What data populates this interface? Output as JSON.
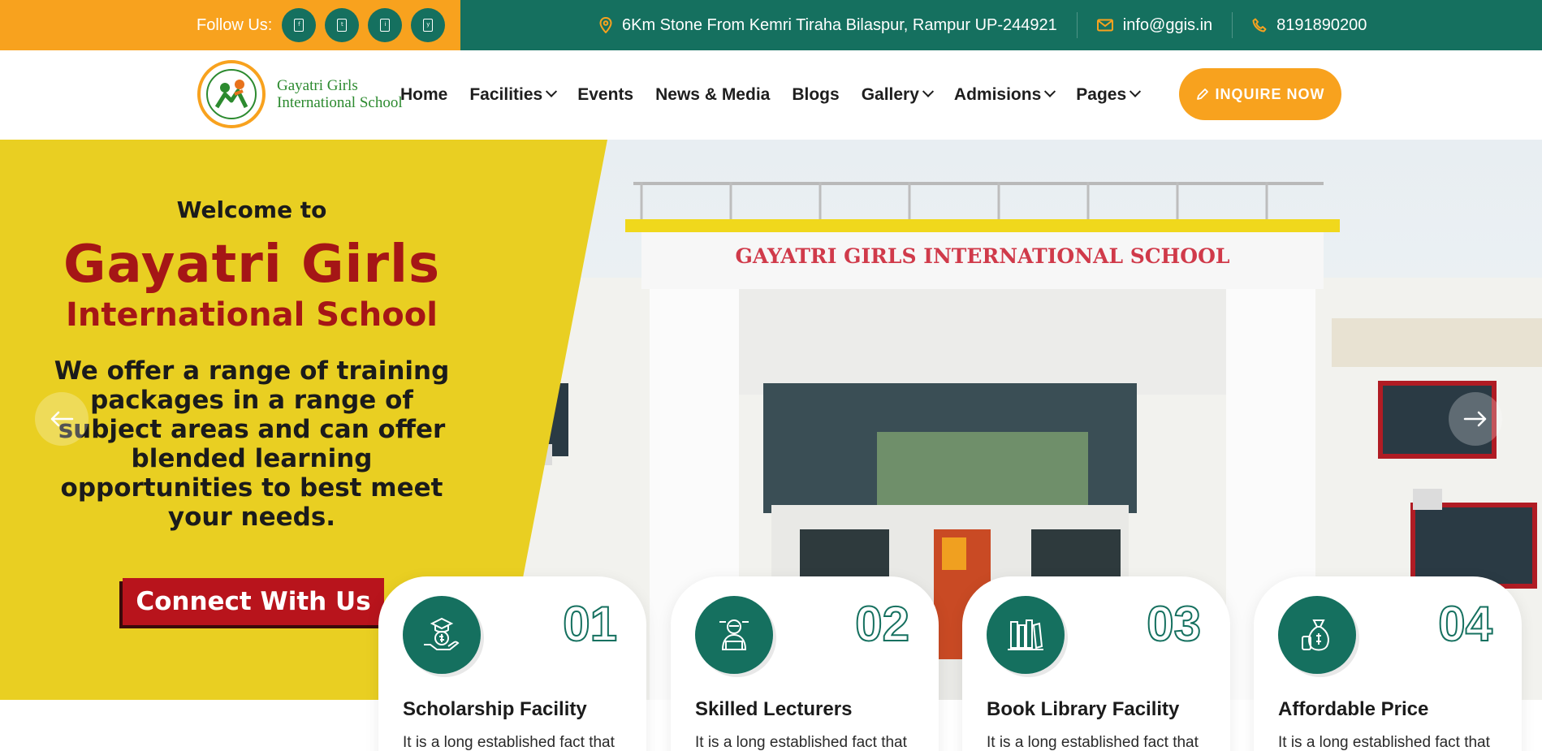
{
  "topbar": {
    "follow_label": "Follow Us:",
    "social_icons": [
      "facebook-icon",
      "twitter-icon",
      "instagram-icon",
      "youtube-icon"
    ],
    "address": "6Km Stone From Kemri Tiraha Bilaspur, Rampur UP-244921",
    "email": "info@ggis.in",
    "phone": "8191890200"
  },
  "logo": {
    "line1": "Gayatri Girls",
    "line2": "International School",
    "emblem_text": "Gayatri Girls International School"
  },
  "nav": {
    "items": [
      {
        "label": "Home",
        "dropdown": false
      },
      {
        "label": "Facilities",
        "dropdown": true
      },
      {
        "label": "Events",
        "dropdown": false
      },
      {
        "label": "News & Media",
        "dropdown": false
      },
      {
        "label": "Blogs",
        "dropdown": false
      },
      {
        "label": "Gallery",
        "dropdown": true
      },
      {
        "label": "Admisions",
        "dropdown": true
      },
      {
        "label": "Pages",
        "dropdown": true
      }
    ],
    "inquire_label": "INQUIRE NOW"
  },
  "hero": {
    "welcome": "Welcome to",
    "school_name_1": "Gayatri Girls",
    "school_name_2": "International School",
    "tagline": "We offer a range of training packages in a range of subject areas and can offer blended learning opportunities to best meet your needs.",
    "connect_label": "Connect With Us",
    "building_sign": "GAYATRI GIRLS  INTERNATIONAL SCHOOL"
  },
  "cards": [
    {
      "num": "01",
      "title": "Scholarship Facility",
      "desc": "It is a long established fact that",
      "icon": "scholarship-icon"
    },
    {
      "num": "02",
      "title": "Skilled Lecturers",
      "desc": "It is a long established fact that",
      "icon": "lecturer-icon"
    },
    {
      "num": "03",
      "title": "Book Library Facility",
      "desc": "It is a long established fact that",
      "icon": "library-icon"
    },
    {
      "num": "04",
      "title": "Affordable Price",
      "desc": "It is a long established fact that",
      "icon": "money-bag-icon"
    }
  ],
  "colors": {
    "brand_green": "#15705f",
    "brand_orange": "#f8a21e",
    "hero_yellow": "#e9cf22",
    "hero_red": "#a51616"
  }
}
